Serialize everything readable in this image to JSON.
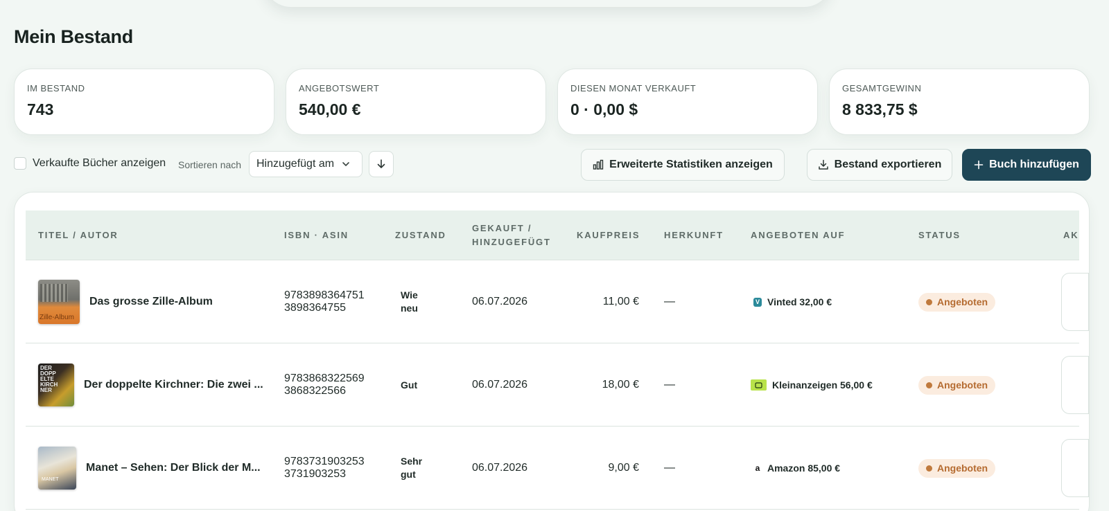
{
  "page": {
    "title": "Mein Bestand"
  },
  "stats": [
    {
      "label": "IM BESTAND",
      "value": "743"
    },
    {
      "label": "ANGEBOTSWERT",
      "value": "540,00 €"
    },
    {
      "label": "DIESEN MONAT VERKAUFT",
      "value": "0 · 0,00 $"
    },
    {
      "label": "GESAMTGEWINN",
      "value": "8 833,75 $"
    }
  ],
  "toolbar": {
    "show_sold_label": "Verkaufte Bücher anzeigen",
    "sort_label": "Sortieren nach",
    "sort_value": "Hinzugefügt am",
    "stats_button": "Erweiterte Statistiken anzeigen",
    "export_button": "Bestand exportieren",
    "add_button": "Buch hinzufügen"
  },
  "table": {
    "columns": {
      "title": "TITEL / AUTOR",
      "isbn": "ISBN · ASIN",
      "condition": "ZUSTAND",
      "bought_line1": "GEKAUFT /",
      "bought_line2": "HINZUGEFÜGT",
      "price": "KAUFPREIS",
      "origin": "HERKUNFT",
      "offered": "ANGEBOTEN AUF",
      "status": "STATUS",
      "actions": "AK"
    },
    "rows": [
      {
        "title": "Das grosse Zille-Album",
        "isbn": "9783898364751",
        "asin": "3898364755",
        "condition_1": "Wie",
        "condition_2": "neu",
        "date": "06.07.2026",
        "price": "11,00 €",
        "origin": "—",
        "offer": "Vinted 32,00 €",
        "status": "Angeboten",
        "cover_text": "Zille-Album"
      },
      {
        "title": "Der doppelte Kirchner: Die zwei ...",
        "isbn": "9783868322569",
        "asin": "3868322566",
        "condition_1": "Gut",
        "condition_2": "",
        "date": "06.07.2026",
        "price": "18,00 €",
        "origin": "—",
        "offer": "Kleinanzeigen 56,00 €",
        "status": "Angeboten",
        "cover_text": "DER DOPP ELTE KIRCH NER"
      },
      {
        "title": "Manet – Sehen: Der Blick der M...",
        "isbn": "9783731903253",
        "asin": "3731903253",
        "condition_1": "Sehr",
        "condition_2": "gut",
        "date": "06.07.2026",
        "price": "9,00 €",
        "origin": "—",
        "offer": "Amazon 85,00 €",
        "status": "Angeboten",
        "cover_text": "MANET"
      }
    ]
  },
  "colors": {
    "background": "#f2f7f4",
    "primary": "#1e4656",
    "badge_bg": "#fbecdf",
    "badge_text": "#b56b30"
  }
}
